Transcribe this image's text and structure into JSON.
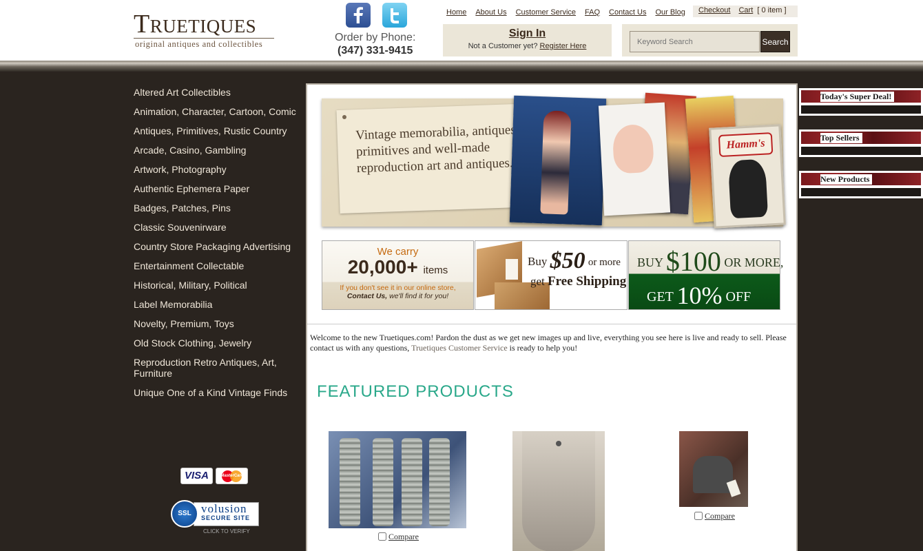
{
  "header": {
    "logo_main": "Truetiques",
    "logo_tagline": "original antiques and collectibles",
    "phone_label": "Order by Phone:",
    "phone_number": "(347) 331-9415",
    "social": [
      {
        "name": "facebook-icon"
      },
      {
        "name": "twitter-icon"
      }
    ],
    "nav": [
      "Home",
      "About Us",
      "Customer Service",
      "FAQ",
      "Contact Us",
      "Our Blog"
    ],
    "checkout_label": "Checkout",
    "cart_label": "Cart",
    "cart_count": "[ 0 item ]",
    "signin_title": "Sign In",
    "signin_prompt": "Not a Customer yet?",
    "register_label": "Register Here",
    "search_placeholder": "Keyword Search",
    "search_button": "Search"
  },
  "sidebar": {
    "categories": [
      "Altered Art Collectibles",
      "Animation, Character, Cartoon, Comic",
      "Antiques, Primitives, Rustic Country",
      "Arcade, Casino, Gambling",
      "Artwork, Photography",
      "Authentic Ephemera Paper",
      "Badges, Patches, Pins",
      "Classic Souvenirware",
      "Country Store Packaging Advertising",
      "Entertainment Collectable",
      "Historical, Military, Political",
      "Label Memorabilia",
      "Novelty, Premium, Toys",
      "Old Stock Clothing, Jewelry",
      "Reproduction Retro Antiques, Art, Furniture",
      "Unique One of a Kind Vintage Finds"
    ],
    "visa_label": "VISA",
    "mastercard_label": "MasterCard",
    "ssl_badge": "SSL",
    "ssl_brand": "volusion",
    "ssl_sub": "SECURE SITE",
    "ssl_click": "CLICK TO VERIFY"
  },
  "main": {
    "hero_text": "Vintage memorabilia, antiques, primitives and well-made reproduction art and antiques.",
    "hero_sign": "Hamm's",
    "promo1": {
      "line1": "We carry",
      "big": "20,000+",
      "unit": "items",
      "line3": "If you don't see it in our online store,",
      "contact": "Contact Us,",
      "line4": "we'll find it for you!"
    },
    "promo2": {
      "buy": "Buy",
      "amount": "$50",
      "or_more": "or more",
      "get": "get",
      "free": "Free Shipping"
    },
    "promo3": {
      "buy": "BUY",
      "amount": "$100",
      "or_more": "OR MORE,",
      "get": "GET",
      "percent": "10%",
      "off": "OFF"
    },
    "welcome_text": "Welcome to the new Truetiques.com! Pardon the dust as we get new images up and live, everything you see here is live and ready to sell. Please contact us with any questions,",
    "welcome_link": "Truetiques Customer Service",
    "welcome_end": "is ready to help you!",
    "featured_title": "FEATURED PRODUCTS",
    "compare_label": "Compare"
  },
  "right_panel": {
    "boxes": [
      "Today's Super Deal!",
      "Top Sellers",
      "New Products"
    ]
  }
}
